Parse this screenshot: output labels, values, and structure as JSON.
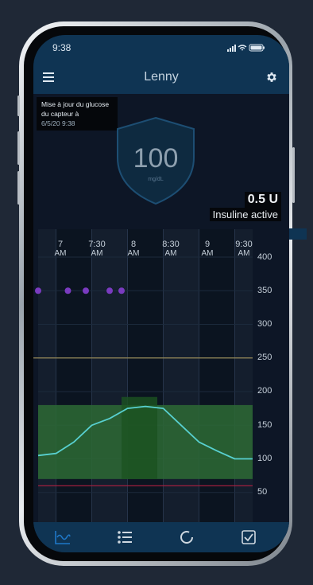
{
  "status": {
    "time": "9:38"
  },
  "header": {
    "title": "Lenny"
  },
  "sensor": {
    "update_text": "Mise à jour du glucose du capteur à",
    "update_date": "6/5/20 9:38"
  },
  "glucose": {
    "value": "100",
    "unit": "mg/dL"
  },
  "insulin": {
    "amount": "0.5 U",
    "label": "Insuline active"
  },
  "chart": {
    "times": [
      {
        "hour": "7",
        "ampm": "AM"
      },
      {
        "hour": "7:30",
        "ampm": "AM"
      },
      {
        "hour": "8",
        "ampm": "AM"
      },
      {
        "hour": "8:30",
        "ampm": "AM"
      },
      {
        "hour": "9",
        "ampm": "AM"
      },
      {
        "hour": "9:30",
        "ampm": "AM"
      }
    ],
    "y_ticks": [
      "400",
      "350",
      "300",
      "250",
      "200",
      "150",
      "100",
      "50"
    ]
  },
  "chart_data": {
    "type": "line",
    "x": [
      "6:45",
      "7:00",
      "7:15",
      "7:30",
      "7:45",
      "8:00",
      "8:15",
      "8:30",
      "8:45",
      "9:00",
      "9:15",
      "9:30",
      "9:45"
    ],
    "series": [
      {
        "values": [
          105,
          108,
          125,
          150,
          160,
          175,
          178,
          175,
          150,
          125,
          112,
          100,
          100
        ]
      }
    ],
    "bolus_markers": {
      "x": [
        "6:45",
        "7:10",
        "7:25",
        "7:45",
        "7:55"
      ],
      "value": 350
    },
    "target_range": [
      70,
      180
    ],
    "high_line": 250,
    "low_line": 60,
    "ylim": [
      0,
      400
    ],
    "colors": {
      "line": "#58d0d0",
      "target": "#2d6a35",
      "markers": "#7a3bc0",
      "high": "#9a8c5a",
      "low": "#b02040"
    }
  },
  "tabs": [
    {
      "name": "tab-dashboard",
      "icon": "chart-icon"
    },
    {
      "name": "tab-history",
      "icon": "list-icon"
    },
    {
      "name": "tab-loop",
      "icon": "circle-icon"
    },
    {
      "name": "tab-tasks",
      "icon": "checkbox-icon"
    }
  ]
}
